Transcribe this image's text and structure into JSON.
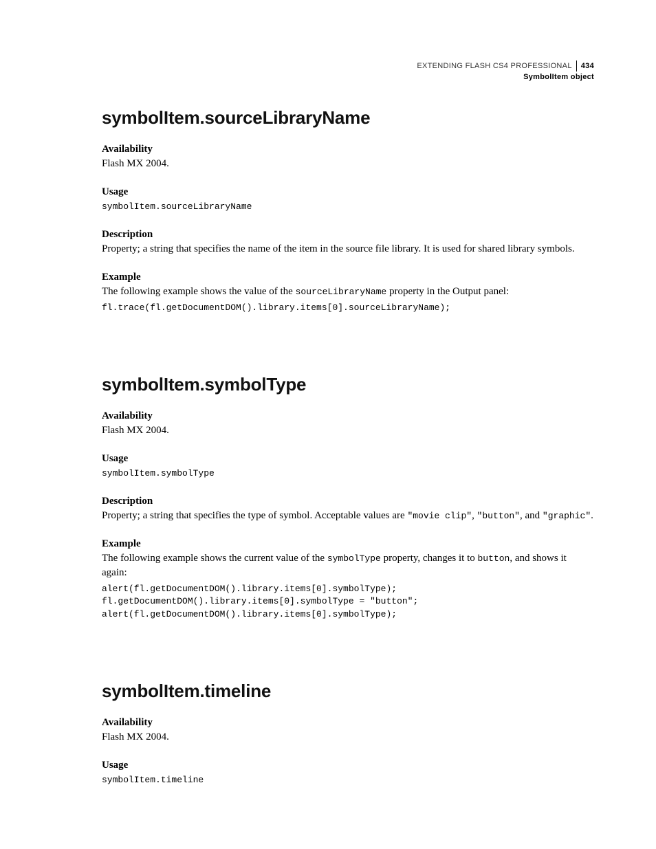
{
  "header": {
    "book_title": "EXTENDING FLASH CS4 PROFESSIONAL",
    "page_number": "434",
    "subtitle": "SymbolItem object"
  },
  "sections": [
    {
      "title": "symbolItem.sourceLibraryName",
      "blocks": [
        {
          "heading": "Availability",
          "body": "Flash MX 2004."
        },
        {
          "heading": "Usage",
          "code": "symbolItem.sourceLibraryName"
        },
        {
          "heading": "Description",
          "body": "Property; a string that specifies the name of the item in the source file library. It is used for shared library symbols."
        },
        {
          "heading": "Example",
          "body_pre": "The following example shows the value of the ",
          "body_mono": "sourceLibraryName",
          "body_post": " property in the Output panel:",
          "code": "fl.trace(fl.getDocumentDOM().library.items[0].sourceLibraryName);"
        }
      ]
    },
    {
      "title": "symbolItem.symbolType",
      "blocks": [
        {
          "heading": "Availability",
          "body": "Flash MX 2004."
        },
        {
          "heading": "Usage",
          "code": "symbolItem.symbolType"
        },
        {
          "heading": "Description",
          "body_pre": "Property; a string that specifies the type of symbol. Acceptable values are ",
          "body_mono": "\"movie clip\"",
          "body_mid1": ", ",
          "body_mono2": "\"button\"",
          "body_mid2": ", and ",
          "body_mono3": "\"graphic\"",
          "body_post": "."
        },
        {
          "heading": "Example",
          "body_pre": "The following example shows the current value of the ",
          "body_mono": "symbolType",
          "body_mid1": " property, changes it to ",
          "body_mono2": "button",
          "body_post": ", and shows it again:",
          "code": "alert(fl.getDocumentDOM().library.items[0].symbolType);\nfl.getDocumentDOM().library.items[0].symbolType = \"button\";\nalert(fl.getDocumentDOM().library.items[0].symbolType);"
        }
      ]
    },
    {
      "title": "symbolItem.timeline",
      "blocks": [
        {
          "heading": "Availability",
          "body": "Flash MX 2004."
        },
        {
          "heading": "Usage",
          "code": "symbolItem.timeline"
        }
      ]
    }
  ]
}
